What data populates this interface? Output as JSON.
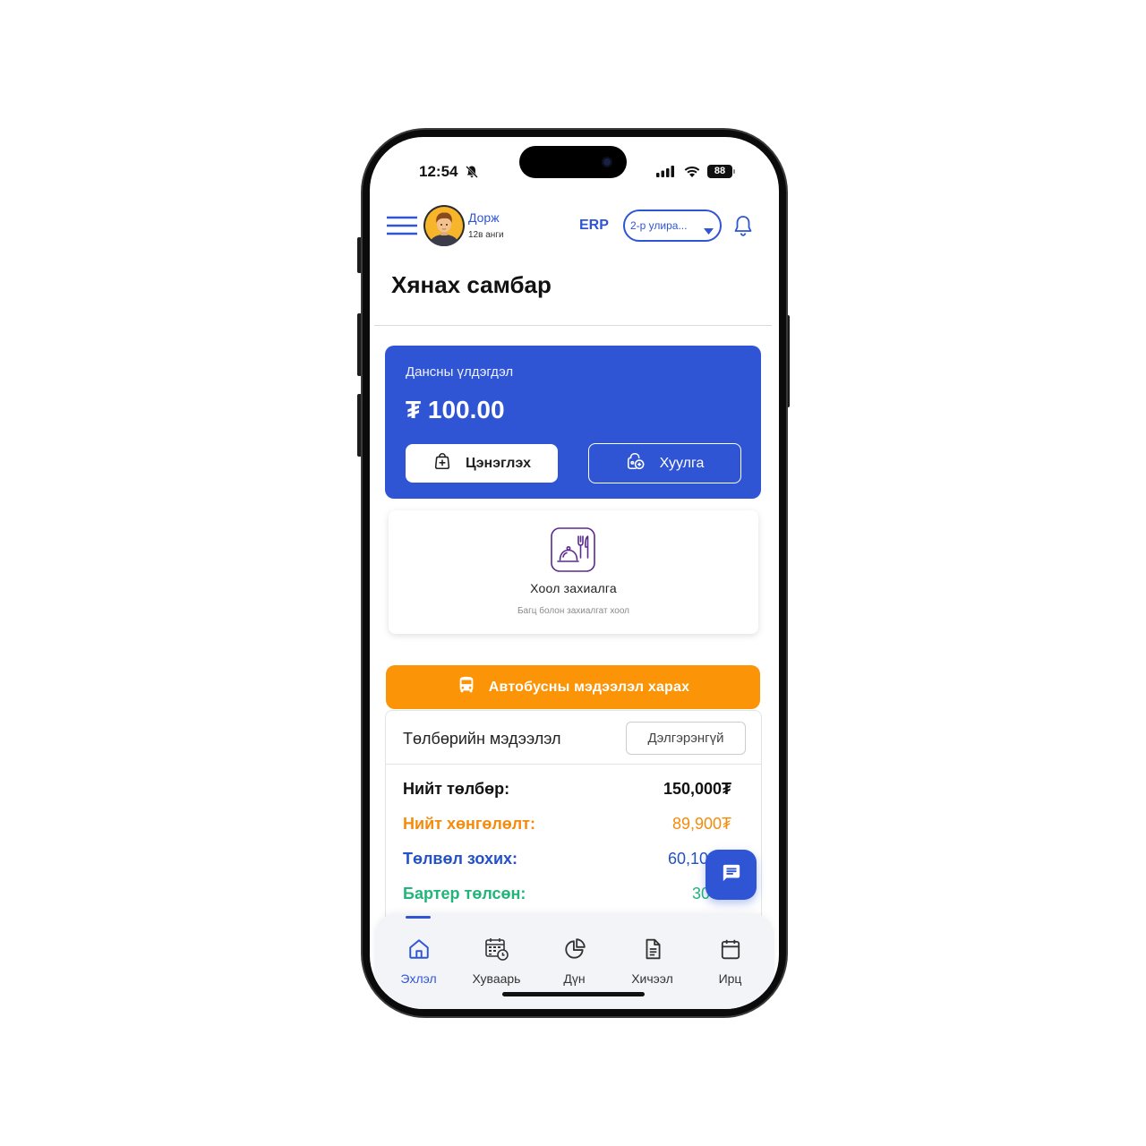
{
  "status_bar": {
    "time": "12:54",
    "battery_level": "88",
    "icons": [
      "bell-slash-icon",
      "signal-icon",
      "wifi-icon",
      "battery-icon"
    ]
  },
  "header": {
    "menu_icon": "hamburger-icon",
    "user": {
      "name": "Дорж",
      "class": "12в анги",
      "avatar": "avatar-boy-icon"
    },
    "erp_label": "ERP",
    "semester_select": {
      "selected": "2-р улира...",
      "icon": "caret-down-icon"
    },
    "notification_icon": "bell-icon"
  },
  "page_title": "Хянах самбар",
  "balance_card": {
    "label": "Дансны үлдэгдэл",
    "amount": "₮ 100.00",
    "topup": {
      "label": "Цэнэглэх",
      "icon": "wallet-plus-icon"
    },
    "statement": {
      "label": "Хуулга",
      "icon": "statement-icon"
    }
  },
  "food_order": {
    "title": "Хоол захиалга",
    "subtitle": "Багц болон захиалгат хоол",
    "icon": "food-service-icon"
  },
  "bus_button": {
    "label": "Автобусны мэдээлэл харах",
    "icon": "bus-icon"
  },
  "payment": {
    "title": "Төлбөрийн мэдээлэл",
    "details_label": "Дэлгэрэнгүй",
    "rows": [
      {
        "label": "Нийт төлбөр:",
        "value": "150,000₮",
        "color": "#111111"
      },
      {
        "label": "Нийт хөнгөлөлт:",
        "value": "89,900₮",
        "color": "#f58b0c"
      },
      {
        "label": "Төлвөл зохих:",
        "value": "60,10",
        "color": "#2450c8"
      },
      {
        "label": "Бартер төлсөн:",
        "value": "30",
        "color": "#22b57a"
      }
    ]
  },
  "chat_button": {
    "icon": "chat-icon"
  },
  "tabs": [
    {
      "label": "Эхлэл",
      "icon": "home-icon",
      "active": true
    },
    {
      "label": "Хуваарь",
      "icon": "calendar-clock-icon",
      "active": false
    },
    {
      "label": "Дүн",
      "icon": "pie-chart-icon",
      "active": false
    },
    {
      "label": "Хичээл",
      "icon": "document-icon",
      "active": false
    },
    {
      "label": "Ирц",
      "icon": "calendar-icon",
      "active": false
    }
  ],
  "colors": {
    "primary": "#2f55d4",
    "orange": "#fb9406",
    "green": "#22b57a",
    "food_icon": "#5a2a8e"
  }
}
